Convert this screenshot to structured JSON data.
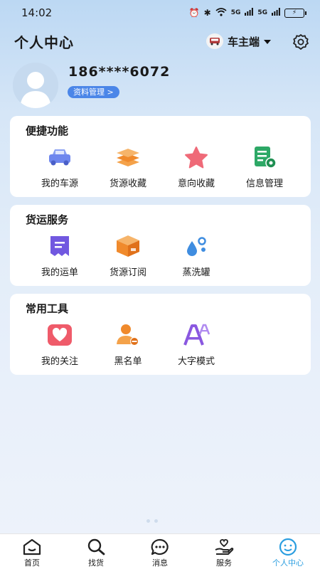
{
  "status_bar": {
    "time": "14:02",
    "signal1": "5G",
    "signal2": "5G"
  },
  "header": {
    "title": "个人中心",
    "role_label": "车主端"
  },
  "profile": {
    "phone": "186****6072",
    "manage_button": "资料管理 >"
  },
  "sections": {
    "quick": {
      "title": "便捷功能",
      "items": [
        {
          "label": "我的车源",
          "icon": "truck-icon"
        },
        {
          "label": "货源收藏",
          "icon": "stack-icon"
        },
        {
          "label": "意向收藏",
          "icon": "star-icon"
        },
        {
          "label": "信息管理",
          "icon": "document-gear-icon"
        }
      ]
    },
    "freight": {
      "title": "货运服务",
      "items": [
        {
          "label": "我的运单",
          "icon": "waybill-icon"
        },
        {
          "label": "货源订阅",
          "icon": "box-icon"
        },
        {
          "label": "蒸洗罐",
          "icon": "water-drops-icon"
        }
      ]
    },
    "tools": {
      "title": "常用工具",
      "items": [
        {
          "label": "我的关注",
          "icon": "heart-icon"
        },
        {
          "label": "黑名单",
          "icon": "user-block-icon"
        },
        {
          "label": "大字模式",
          "icon": "font-size-icon"
        }
      ]
    }
  },
  "bottom_nav": {
    "items": [
      {
        "label": "首页",
        "icon": "home-icon"
      },
      {
        "label": "找货",
        "icon": "search-icon"
      },
      {
        "label": "消息",
        "icon": "message-icon"
      },
      {
        "label": "服务",
        "icon": "service-icon"
      },
      {
        "label": "个人中心",
        "icon": "profile-icon"
      }
    ],
    "active_index": 4
  },
  "colors": {
    "accent": "#2b9ee0",
    "profile_button": "#4b86e8",
    "truck": "#6e86ee",
    "stack": "#f08a2c",
    "star": "#ef6a78",
    "document": "#2da866",
    "waybill": "#7158e0",
    "box": "#f08a2c",
    "drops": "#3f8de0",
    "heart": "#ef5b6a",
    "user_block": "#f08a2c",
    "font": "#8a58e0"
  }
}
